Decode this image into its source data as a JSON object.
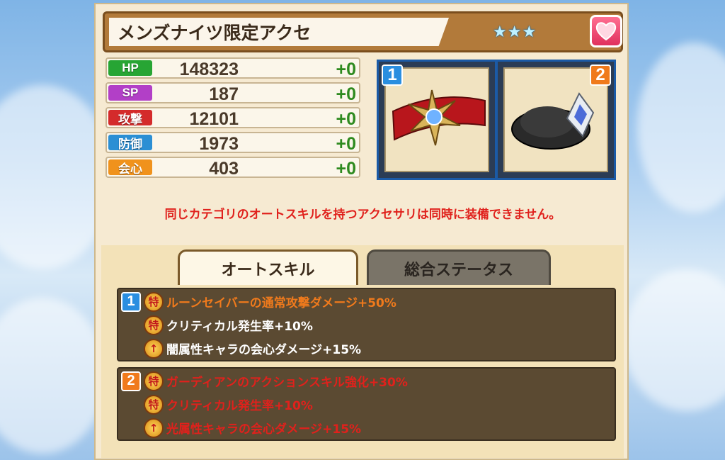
{
  "title": "メンズナイツ限定アクセ",
  "rarity_stars": "★★★",
  "stats": [
    {
      "label": "HP",
      "value": "148323",
      "bonus": "+0",
      "color": "#27a534"
    },
    {
      "label": "SP",
      "value": "187",
      "bonus": "+0",
      "color": "#b23fc7"
    },
    {
      "label": "攻撃",
      "value": "12101",
      "bonus": "+0",
      "color": "#d42b2b"
    },
    {
      "label": "防御",
      "value": "1973",
      "bonus": "+0",
      "color": "#2b8fd4"
    },
    {
      "label": "会心",
      "value": "403",
      "bonus": "+0",
      "color": "#f0921c"
    }
  ],
  "slots": [
    {
      "number": "1",
      "badge_color": "#2a8ee0",
      "icon": "red-belt-star-accessory-icon"
    },
    {
      "number": "2",
      "badge_color": "#f07a1c",
      "icon": "black-hat-crystal-accessory-icon"
    }
  ],
  "warning": "同じカテゴリのオートスキルを持つアクセサリは同時に装備できません。",
  "tabs": {
    "auto_skill": "オートスキル",
    "total_status": "総合ステータス"
  },
  "skill_groups": [
    {
      "number": "1",
      "badge_color": "#2a8ee0",
      "skills": [
        {
          "text": "ルーンセイバーの通常攻撃ダメージ+50%",
          "color": "#f07a1c",
          "icon": "toku-icon"
        },
        {
          "text": "クリティカル発生率+10%",
          "color": "#ffffff",
          "icon": "toku-icon"
        },
        {
          "text": "闇属性キャラの会心ダメージ+15%",
          "color": "#ffffff",
          "icon": "critical-up-icon"
        }
      ]
    },
    {
      "number": "2",
      "badge_color": "#f07a1c",
      "skills": [
        {
          "text": "ガーディアンのアクションスキル強化+30%",
          "color": "#e0211c",
          "icon": "toku-icon"
        },
        {
          "text": "クリティカル発生率+10%",
          "color": "#e0211c",
          "icon": "toku-icon"
        },
        {
          "text": "光属性キャラの会心ダメージ+15%",
          "color": "#e0211c",
          "icon": "critical-up-icon"
        }
      ]
    }
  ]
}
